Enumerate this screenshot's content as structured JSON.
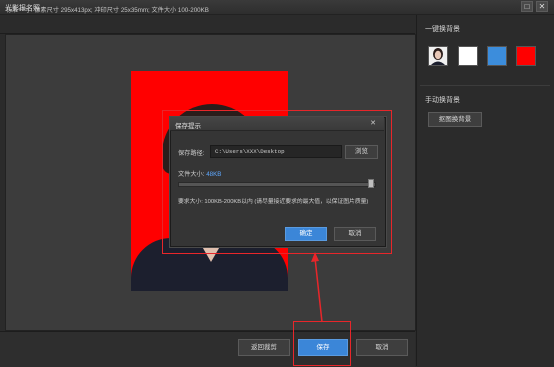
{
  "window": {
    "title": "光影报名照",
    "restore_icon": "□",
    "close_icon": "✕"
  },
  "spec": {
    "text": "标准一寸: 像素尺寸 295x413px; 冲印尺寸 25x35mm; 文件大小 100-200KB"
  },
  "right_panel": {
    "onekey_title": "一键换背景",
    "manual_title": "手动换背景",
    "manual_button": "抠图换背景",
    "swatches": [
      {
        "name": "portrait-thumbnail",
        "color": "#e8e8e8"
      },
      {
        "name": "white-background",
        "color": "#ffffff"
      },
      {
        "name": "blue-background",
        "color": "#3c8ddc"
      },
      {
        "name": "red-background",
        "color": "#ff0000"
      }
    ]
  },
  "dialog": {
    "title": "保存提示",
    "close_icon": "✕",
    "path_label": "保存路径:",
    "path_value": "C:\\Users\\XXX\\Desktop",
    "browse_label": "浏览",
    "size_label": "文件大小:",
    "size_value": "48KB",
    "slider_level": 0.99,
    "requirement": "要求大小: 100KB-200KB以内 (请尽量接近要求的最大值，以保证图片质量)",
    "ok_label": "确定",
    "cancel_label": "取消"
  },
  "bottom": {
    "back_label": "返回裁剪",
    "save_label": "保存",
    "cancel_label": "取消"
  },
  "colors": {
    "accent": "#3b86d8",
    "annotation": "#e8262a",
    "photo_background": "#ff0000"
  }
}
